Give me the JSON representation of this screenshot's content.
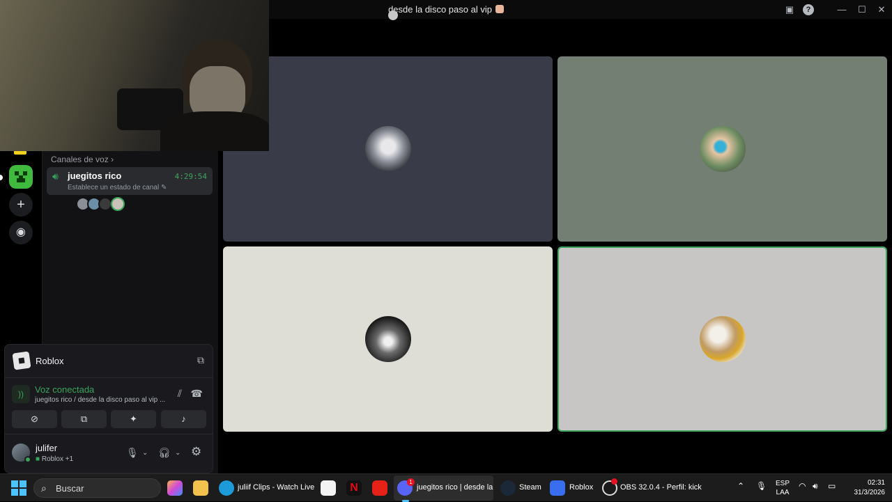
{
  "window": {
    "title": "desde la disco paso al vip"
  },
  "sidebar": {
    "voice_header": "Canales de voz",
    "voice_channel": {
      "name": "juegitos rico",
      "timer": "4:29:54",
      "status": "Establece un estado de canal"
    }
  },
  "panel": {
    "activity_name": "Roblox",
    "voice": {
      "title": "Voz conectada",
      "subtitle": "juegitos rico / desde la disco paso al vip ..."
    },
    "user": {
      "name": "julifer",
      "status": "Roblox",
      "extra": "+1"
    }
  },
  "taskbar": {
    "search_placeholder": "Buscar",
    "apps": [
      {
        "label": "juliif Clips - Watch Live"
      },
      {
        "label": "juegitos rico | desde la"
      },
      {
        "label": "Steam"
      },
      {
        "label": "Roblox"
      },
      {
        "label": "OBS 32.0.4 - Perfil: kick"
      }
    ],
    "discord_badge": "1",
    "lang_top": "ESP",
    "lang_bottom": "LAA",
    "time": "02:31",
    "date": "31/3/2026"
  },
  "colors": {
    "accent_green": "#3ba55d",
    "windows_accent": "#4cc2ff"
  }
}
